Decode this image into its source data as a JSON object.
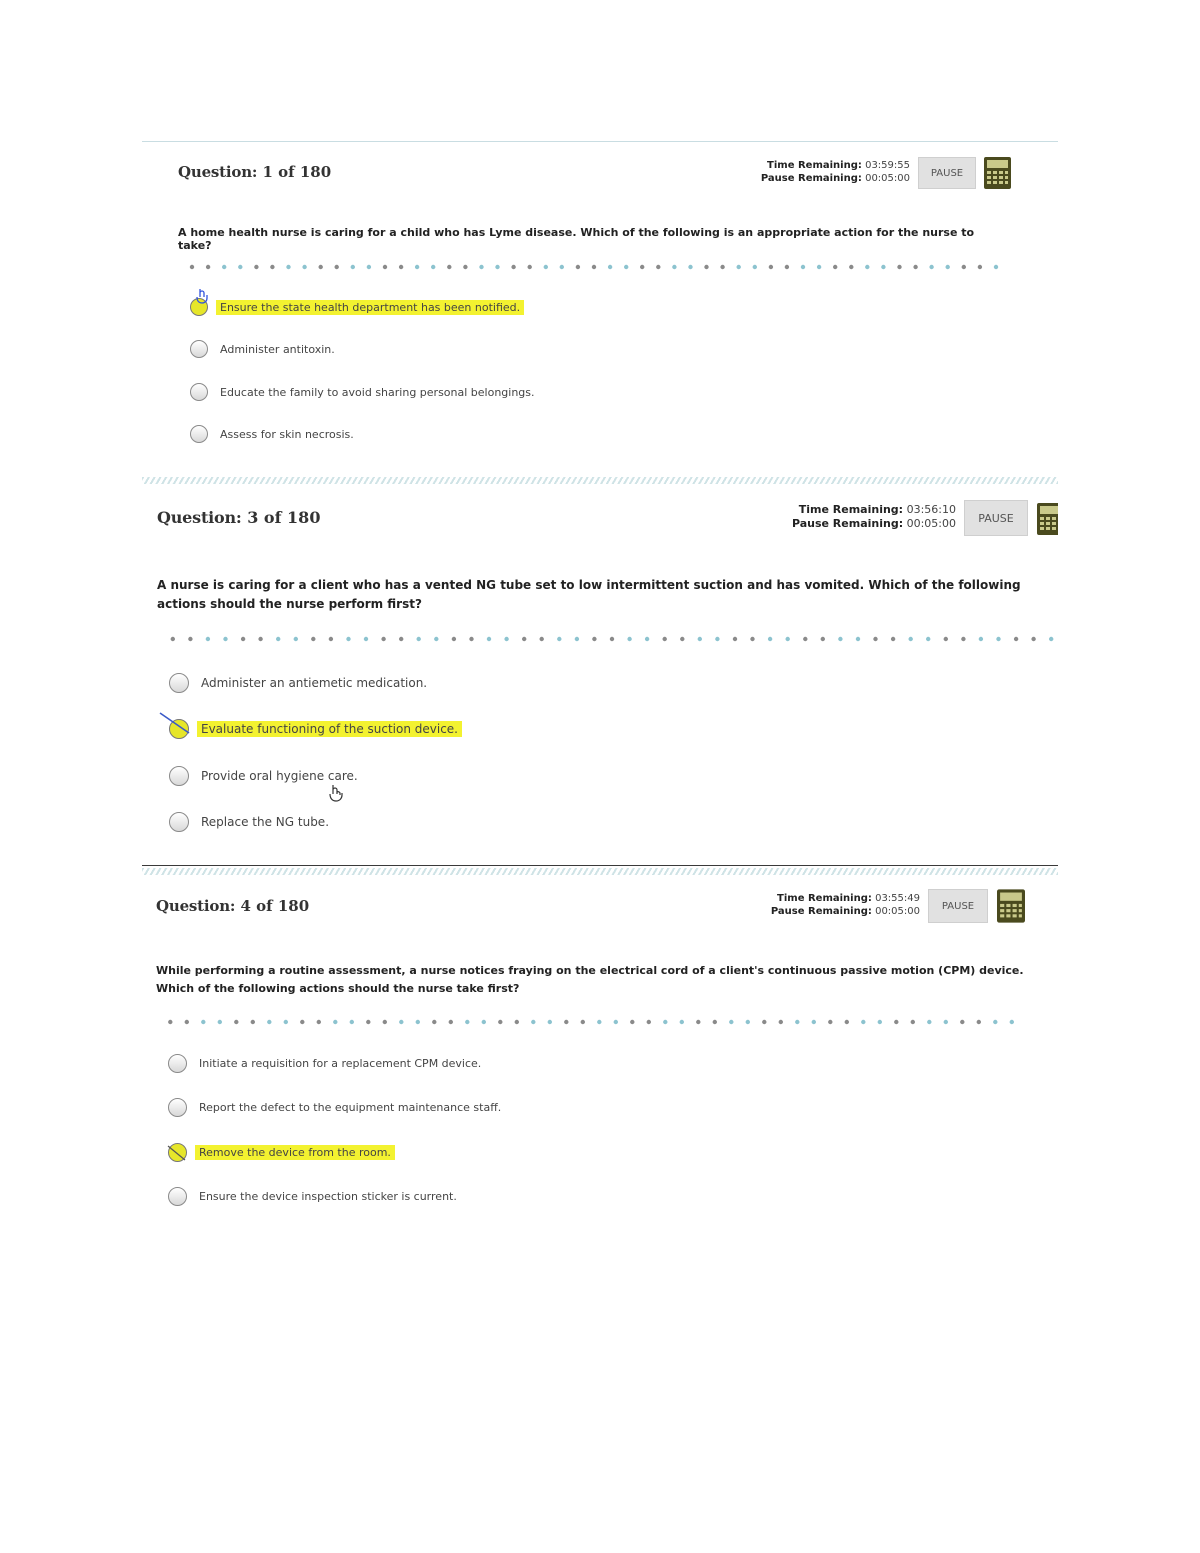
{
  "questions": [
    {
      "prefix": "Question:",
      "number_label": "1 of 180",
      "time_label": "Time Remaining:",
      "time_value": "03:59:55",
      "pause_label": "Pause Remaining:",
      "pause_value": "00:05:00",
      "pause_button": "PAUSE",
      "text": "A home health nurse is caring for a child who has Lyme disease. Which of the following is an appropriate action for the nurse to take?",
      "options": [
        "Ensure the state health department has been notified.",
        "Administer antitoxin.",
        "Educate the family to avoid sharing personal belongings.",
        "Assess for skin necrosis."
      ],
      "highlighted_option": 0
    },
    {
      "prefix": "Question:",
      "number_label": "3 of 180",
      "time_label": "Time Remaining:",
      "time_value": "03:56:10",
      "pause_label": "Pause Remaining:",
      "pause_value": "00:05:00",
      "pause_button": "PAUSE",
      "text": "A nurse is caring for a client who has a vented NG tube set to low intermittent suction and has vomited. Which of the following actions should the nurse perform first?",
      "options": [
        "Administer an antiemetic medication.",
        "Evaluate functioning of the suction device.",
        "Provide oral hygiene care.",
        "Replace the NG tube."
      ],
      "highlighted_option": 1
    },
    {
      "prefix": "Question:",
      "number_label": "4 of 180",
      "time_label": "Time Remaining:",
      "time_value": "03:55:49",
      "pause_label": "Pause Remaining:",
      "pause_value": "00:05:00",
      "pause_button": "PAUSE",
      "text": "While performing a routine assessment, a nurse notices fraying on the electrical cord of a client's continuous passive motion (CPM) device. Which of the following actions should the nurse take first?",
      "options": [
        "Initiate a requisition for a replacement CPM device.",
        "Report the defect to the equipment maintenance staff.",
        "Remove the device from the room.",
        "Ensure the device inspection sticker is current."
      ],
      "highlighted_option": 2
    }
  ],
  "colors": {
    "highlight": "#f3f230",
    "calculator": "#4a4a1e",
    "dot_dark": "#8a8a8a",
    "dot_teal": "#8cc3cf",
    "separator": "#cfe3e6"
  },
  "icons": {
    "calculator": "calculator-icon",
    "pointer": "hand-pointer-icon"
  }
}
